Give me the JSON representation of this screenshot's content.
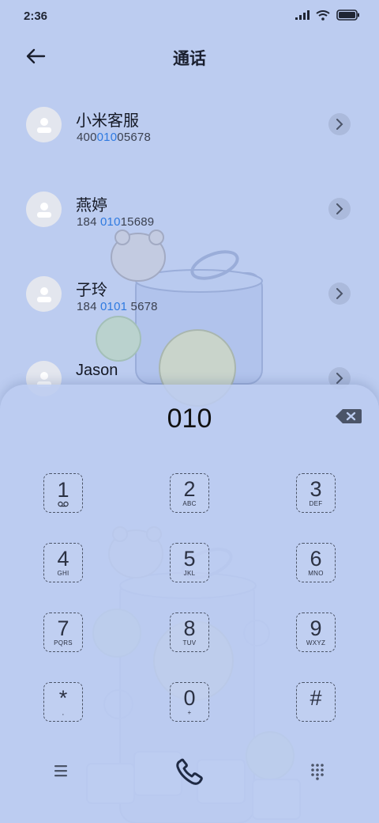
{
  "status_bar": {
    "time": "2:36",
    "icons": [
      "signal-icon",
      "wifi-icon",
      "battery-icon"
    ]
  },
  "header": {
    "title": "通话",
    "back_icon": "arrow-left-icon"
  },
  "contacts": [
    {
      "name": "小米客服",
      "number_pre": "400",
      "number_hl": "010",
      "number_post": "05678"
    },
    {
      "name": "燕婷",
      "number_pre": "184 ",
      "number_hl": "010",
      "number_post": "15689"
    },
    {
      "name": "子玲",
      "number_pre": "184 ",
      "number_hl": "0101",
      "number_post": " 5678"
    },
    {
      "name": "Jason",
      "number_pre": "",
      "number_hl": "",
      "number_post": ""
    }
  ],
  "dialer": {
    "input": "010",
    "keys": [
      {
        "digit": "1",
        "sub": ""
      },
      {
        "digit": "2",
        "sub": "ABC"
      },
      {
        "digit": "3",
        "sub": "DEF"
      },
      {
        "digit": "4",
        "sub": "GHI"
      },
      {
        "digit": "5",
        "sub": "JKL"
      },
      {
        "digit": "6",
        "sub": "MNO"
      },
      {
        "digit": "7",
        "sub": "PQRS"
      },
      {
        "digit": "8",
        "sub": "TUV"
      },
      {
        "digit": "9",
        "sub": "WXYZ"
      },
      {
        "digit": "*",
        "sub": ","
      },
      {
        "digit": "0",
        "sub": "+"
      },
      {
        "digit": "#",
        "sub": ""
      }
    ]
  },
  "colors": {
    "background": "#bcccf0",
    "highlight": "#2f7ae0",
    "icon": "#4b5468"
  }
}
